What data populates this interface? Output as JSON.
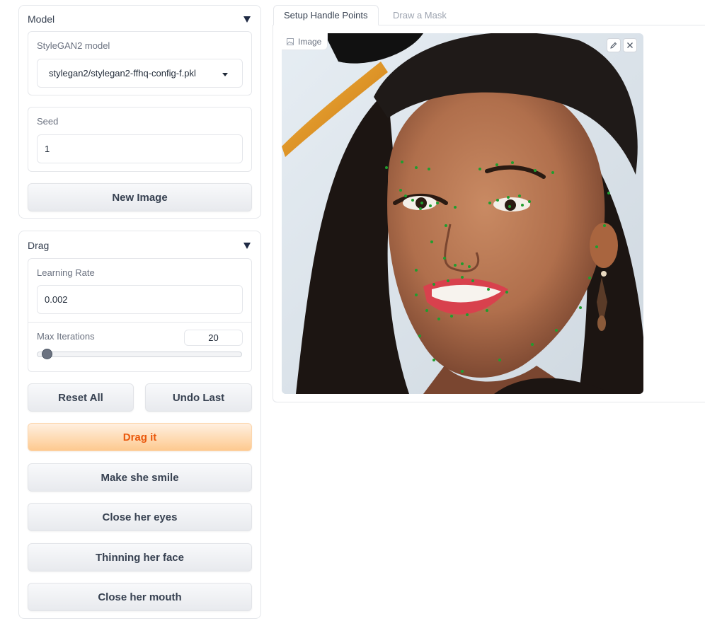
{
  "model_panel": {
    "title": "Model",
    "model_label": "StyleGAN2 model",
    "model_value": "stylegan2/stylegan2-ffhq-config-f.pkl",
    "seed_label": "Seed",
    "seed_value": "1",
    "new_image_label": "New Image"
  },
  "drag_panel": {
    "title": "Drag",
    "lr_label": "Learning Rate",
    "lr_value": "0.002",
    "max_iter_label": "Max Iterations",
    "max_iter_value": "20",
    "max_iter_fraction": 0.04,
    "reset_label": "Reset All",
    "undo_label": "Undo Last",
    "drag_label": "Drag it",
    "smile_label": "Make she smile",
    "eyes_label": "Close her eyes",
    "thin_label": "Thinning her face",
    "mouth_label": "Close her mouth"
  },
  "tabs": [
    "Setup Handle Points",
    "Draw a Mask"
  ],
  "image": {
    "label": "Image",
    "edit_icon": "pencil-icon",
    "close_icon": "close-icon",
    "point_color": "#1f9e2e"
  },
  "colors": {
    "primary_text": "#ea580c",
    "primary_bg": "#fdc98f"
  }
}
